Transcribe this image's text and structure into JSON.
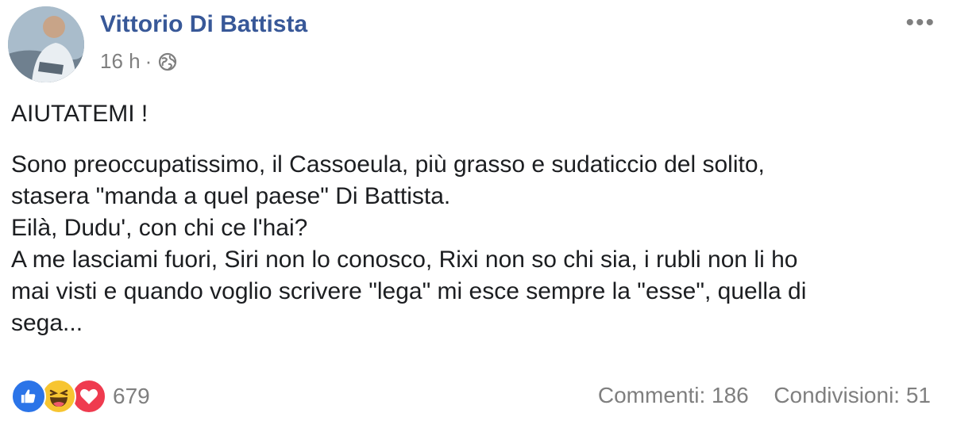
{
  "post": {
    "author": "Vittorio Di Battista",
    "time": "16 h",
    "separator": "·",
    "privacy_icon": "globe-icon",
    "more_label": "•••",
    "text": {
      "title": "AIUTATEMI !",
      "line1": "Sono preoccupatissimo, il Cassoeula, più grasso e sudaticcio del solito,",
      "line2": "stasera \"manda a quel paese\" Di Battista.",
      "line3": "Eilà, Dudu', con chi ce l'hai?",
      "line4": "A me lasciami fuori, Siri non lo conosco, Rixi non so chi sia, i rubli non li ho",
      "line5": "mai visti e quando voglio scrivere \"lega\" mi esce sempre la \"esse\", quella di",
      "line6": "sega..."
    }
  },
  "footer": {
    "reaction_icons": [
      "like-icon",
      "haha-icon",
      "love-icon"
    ],
    "reaction_count": "679",
    "comments": "Commenti: 186",
    "shares": "Condivisioni: 51"
  },
  "colors": {
    "author_link": "#385898",
    "meta_text": "#7f7f7f",
    "body_text": "#1c1e21",
    "like": "#2b74e8",
    "haha": "#f7c531",
    "love": "#ef3b4f"
  }
}
